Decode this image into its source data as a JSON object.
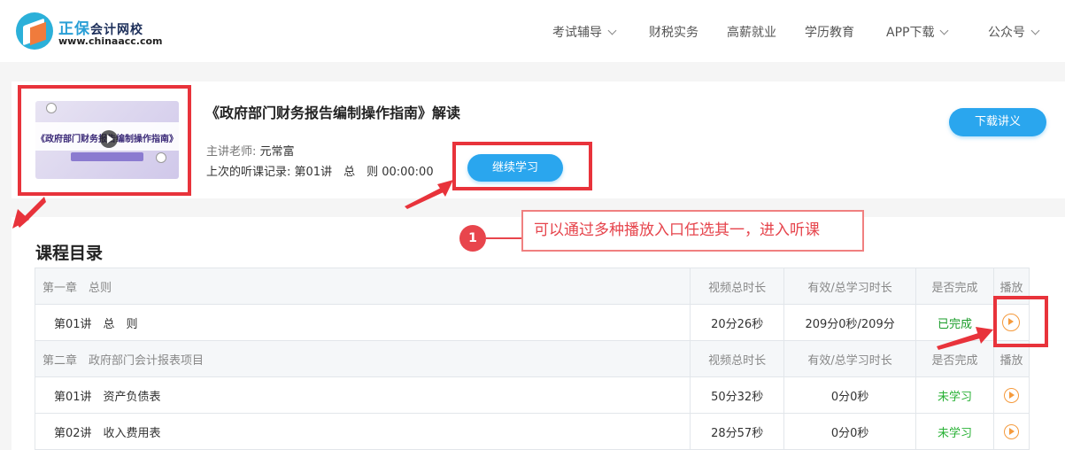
{
  "header": {
    "logo_main": "正保",
    "logo_sub": "会计网校",
    "logo_url": "www.chinaacc.com",
    "nav": [
      {
        "label": "考试辅导",
        "has_dropdown": true
      },
      {
        "label": "财税实务",
        "has_dropdown": false
      },
      {
        "label": "高薪就业",
        "has_dropdown": false
      },
      {
        "label": "学历教育",
        "has_dropdown": false
      },
      {
        "label": "APP下载",
        "has_dropdown": true
      },
      {
        "label": "公众号",
        "has_dropdown": true
      }
    ]
  },
  "course": {
    "thumbnail_title": "《政府部门财务报告编制操作指南》",
    "title": "《政府部门财务报告编制操作指南》解读",
    "teacher_label": "主讲老师:",
    "teacher_name": "元常富",
    "record_label": "上次的听课记录:",
    "record_value": "第01讲　总　则 00:00:00",
    "continue_button": "继续学习",
    "download_button": "下载讲义"
  },
  "annotation": {
    "badge": "1",
    "tip": "可以通过多种播放入口任选其一，进入听课"
  },
  "catalog": {
    "title": "课程目录",
    "chapters": [
      {
        "name": "第一章　总则",
        "headers": [
          "视频总时长",
          "有效/总学习时长",
          "是否完成",
          "播放"
        ],
        "lectures": [
          {
            "name": "第01讲　总　则",
            "duration": "20分26秒",
            "study": "209分0秒/209分",
            "status": "已完成"
          }
        ]
      },
      {
        "name": "第二章　政府部门会计报表项目",
        "headers": [
          "视频总时长",
          "有效/总学习时长",
          "是否完成",
          "播放"
        ],
        "lectures": [
          {
            "name": "第01讲　资产负债表",
            "duration": "50分32秒",
            "study": "0分0秒",
            "status": "未学习"
          },
          {
            "name": "第02讲　收入费用表",
            "duration": "28分57秒",
            "study": "0分0秒",
            "status": "未学习"
          }
        ]
      }
    ]
  },
  "colors": {
    "accent": "#2aa6ee",
    "highlight": "#e8333b",
    "play_icon": "#f59a3c",
    "done": "#1a9c2a"
  }
}
